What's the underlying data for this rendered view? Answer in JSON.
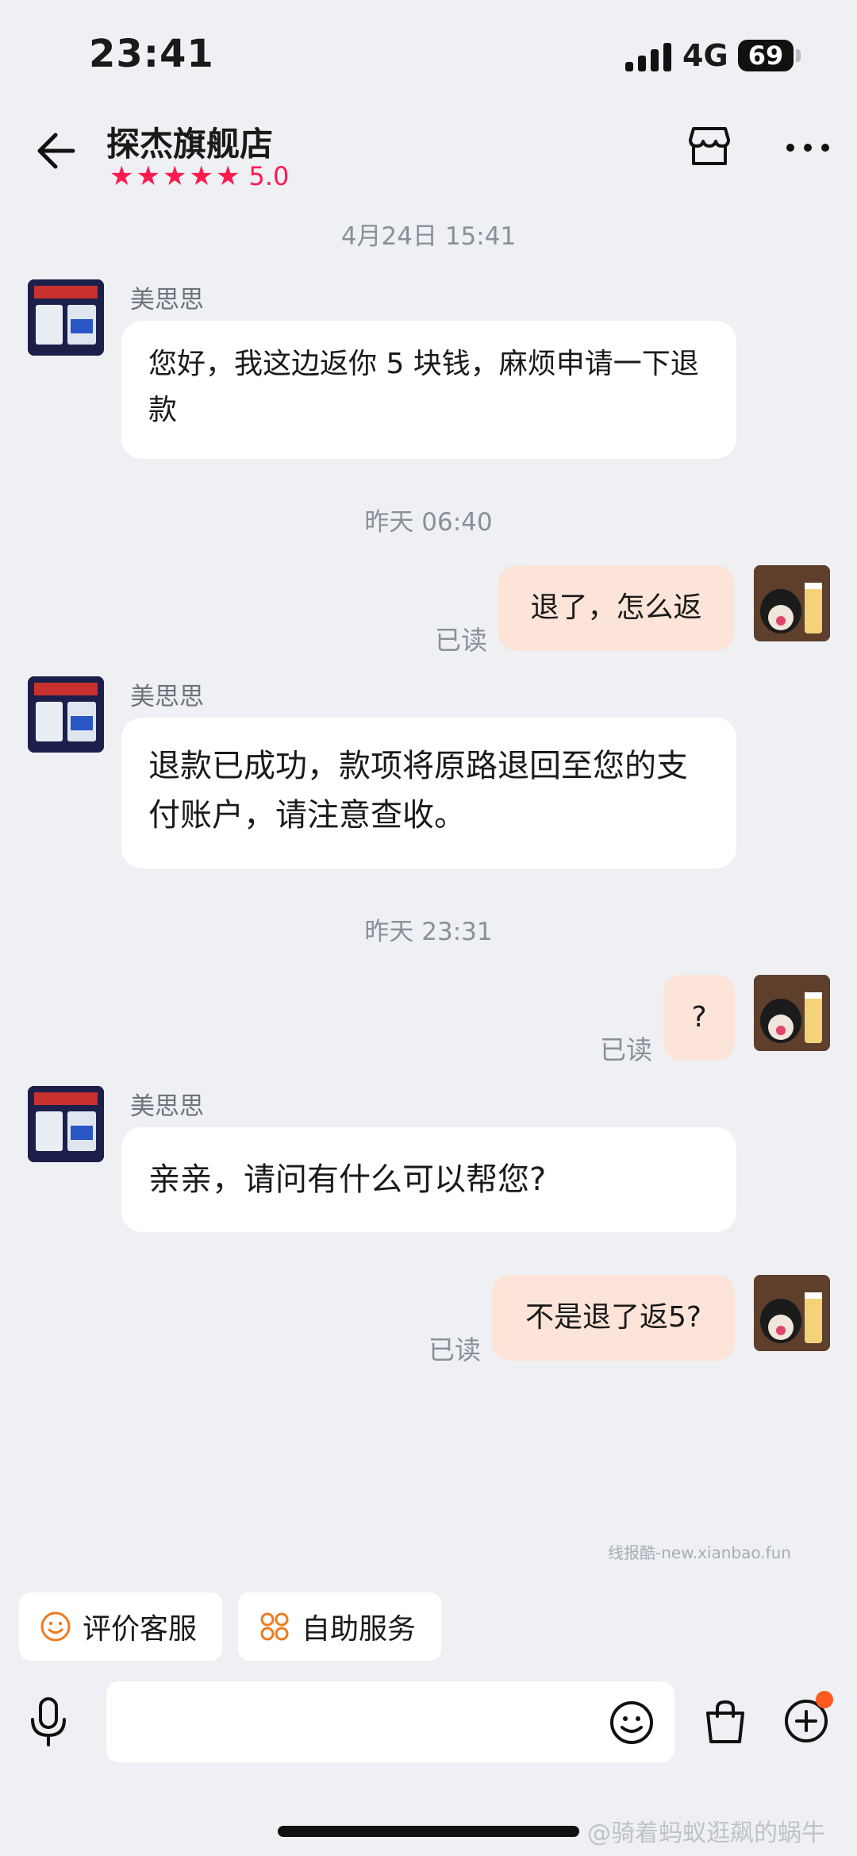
{
  "status_bar": {
    "time": "23:41",
    "network": "4G",
    "battery": "69"
  },
  "header": {
    "title": "探杰旗舰店",
    "rating": "5.0",
    "stars": 5
  },
  "messages": [
    {
      "type": "timestamp",
      "text": "4月24日 15:41"
    },
    {
      "type": "incoming",
      "sender": "美思思",
      "text": "您好，我这边返你 5 块钱，麻烦申请一下退款"
    },
    {
      "type": "timestamp",
      "text": "昨天 06:40"
    },
    {
      "type": "outgoing",
      "text": "退了，怎么返",
      "status": "已读"
    },
    {
      "type": "incoming",
      "sender": "美思思",
      "text": "退款已成功，款项将原路退回至您的支付账户，请注意查收。"
    },
    {
      "type": "timestamp",
      "text": "昨天 23:31"
    },
    {
      "type": "outgoing",
      "text": "?",
      "status": "已读"
    },
    {
      "type": "incoming",
      "sender": "美思思",
      "text": "亲亲，请问有什么可以帮您?"
    },
    {
      "type": "outgoing",
      "text": "不是退了返5?",
      "status": "已读"
    }
  ],
  "watermark": "线报酷-new.xianbao.fun",
  "quick_actions": [
    {
      "label": "评价客服",
      "icon": "smile-icon"
    },
    {
      "label": "自助服务",
      "icon": "grid-icon"
    }
  ],
  "footer_watermark": "@骑着蚂蚁逛飙的蜗牛",
  "colors": {
    "accent": "#ff1a50",
    "outgoing_bubble": "#fde4d8",
    "quick_action_icon": "#f07a1c"
  }
}
